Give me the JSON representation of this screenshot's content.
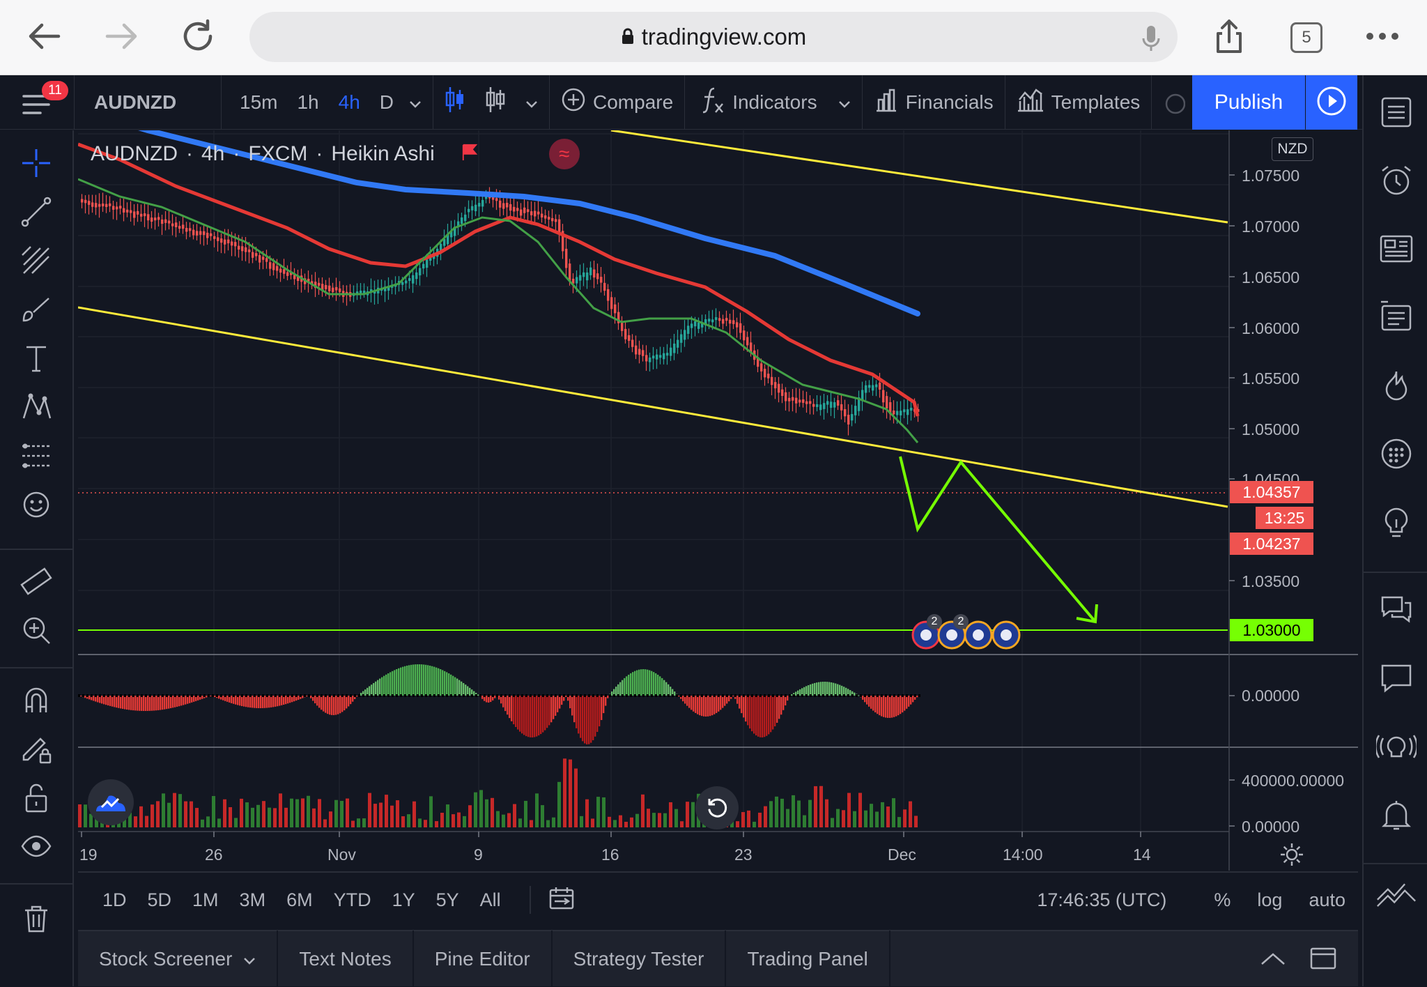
{
  "browser": {
    "url": "tradingview.com",
    "tab_count": "5"
  },
  "toolbar": {
    "symbol": "AUDNZD",
    "intervals": [
      "15m",
      "1h",
      "4h",
      "D"
    ],
    "active_interval": "4h",
    "compare_label": "Compare",
    "indicators_label": "Indicators",
    "financials_label": "Financials",
    "templates_label": "Templates",
    "publish_label": "Publish",
    "notification_count": "11"
  },
  "legend": {
    "symbol": "AUDNZD",
    "interval": "4h",
    "exchange": "FXCM",
    "chart_style": "Heikin Ashi",
    "separator": "·",
    "wave_glyph": "≈"
  },
  "currency": "NZD",
  "price_axis": {
    "labels": [
      "1.07500",
      "1.07000",
      "1.06500",
      "1.06000",
      "1.05500",
      "1.05000",
      "1.04500",
      "1.03500"
    ],
    "last_price": "1.04357",
    "countdown": "13:25",
    "bid_price": "1.04237",
    "level_price": "1.03000",
    "osc_zero": "0.00000",
    "vol_max": "400000.00000",
    "vol_zero": "0.00000"
  },
  "time_axis": {
    "labels": [
      "19",
      "26",
      "Nov",
      "9",
      "16",
      "23",
      "Dec",
      "14:00",
      "14"
    ]
  },
  "events": {
    "badges": [
      "2",
      "2"
    ]
  },
  "range_bar": {
    "ranges": [
      "1D",
      "5D",
      "1M",
      "3M",
      "6M",
      "YTD",
      "1Y",
      "5Y",
      "All"
    ],
    "clock": "17:46:35 (UTC)",
    "percent_label": "%",
    "log_label": "log",
    "auto_label": "auto"
  },
  "bottom_panel": {
    "tabs": [
      "Stock Screener",
      "Text Notes",
      "Pine Editor",
      "Strategy Tester",
      "Trading Panel"
    ]
  },
  "colors": {
    "background": "#131722",
    "accent": "#2962ff",
    "up": "#26a69a",
    "down": "#ef5350",
    "channel": "#ffeb3b",
    "projection": "#76ff03",
    "ma_slow": "#3179f5",
    "ma_mid": "#e53935",
    "ma_fast": "#43a047"
  }
}
